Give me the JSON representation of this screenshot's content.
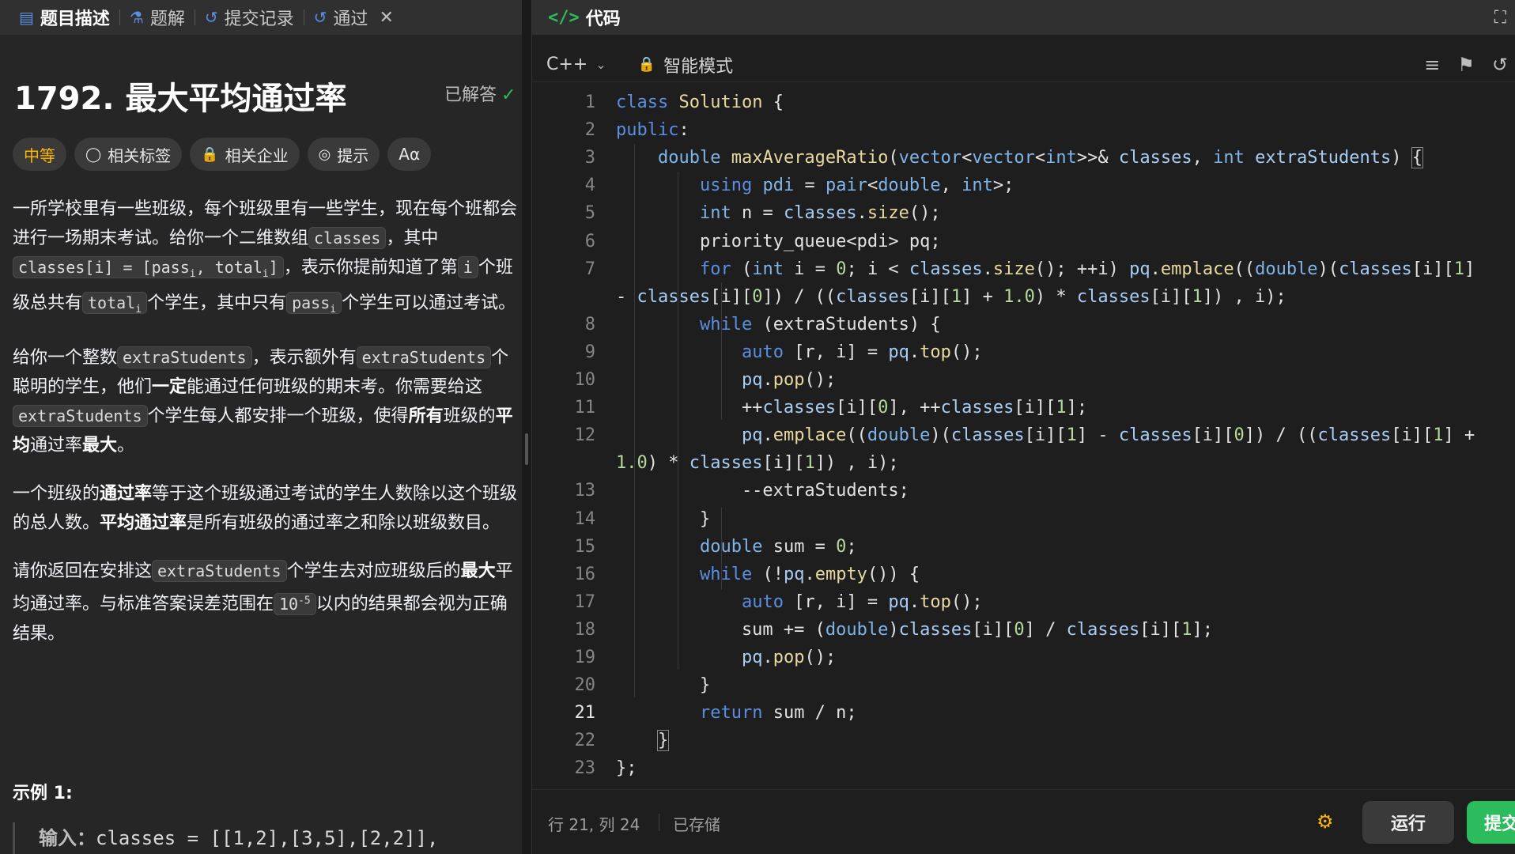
{
  "left_tabs": [
    {
      "icon": "document-icon",
      "label": "题目描述",
      "active": true
    },
    {
      "icon": "flask-icon",
      "label": "题解",
      "active": false
    },
    {
      "icon": "history-icon",
      "label": "提交记录",
      "active": false
    },
    {
      "icon": "history-icon",
      "label": "通过",
      "active": false
    }
  ],
  "problem": {
    "title": "1792. 最大平均通过率",
    "status": "已解答",
    "tags": {
      "difficulty": "中等",
      "related_tags": "相关标签",
      "related_companies": "相关企业",
      "hints": "提示",
      "font": "Aα"
    }
  },
  "description": {
    "p1_a": "一所学校里有一些班级，每个班级里有一些学生，现在每个班都会进行一场期末考试。给你一个二维数组",
    "p1_classes": "classes",
    "p1_b": "，其中",
    "p1_classes_i": "classes[i] = [pass",
    "p1_classes_i_mid": ", total",
    "p1_classes_i_end": "]",
    "p1_c": "，表示你提前知道了第",
    "p1_i": "i",
    "p1_d": "个班级总共有",
    "p1_total": "total",
    "p1_e": "个学生，其中只有",
    "p1_pass": "pass",
    "p1_f": "个学生可以通过考试。",
    "sub_i": "i",
    "p2_a": "给你一个整数",
    "p2_extra": "extraStudents",
    "p2_b": "，表示额外有",
    "p2_c": "个聪明的学生，他们",
    "p2_yiding": "一定",
    "p2_d": "能通过任何班级的期末考。你需要给这",
    "p2_e": "个学生每人都安排一个班级，使得",
    "p2_suoyou": "所有",
    "p2_f": "班级的",
    "p2_pingjun": "平均",
    "p2_g": "通过率",
    "p2_zuida": "最大",
    "p2_h": "。",
    "p3_a": "一个班级的",
    "p3_tongguolv": "通过率",
    "p3_b": "等于这个班级通过考试的学生人数除以这个班级的总人数。",
    "p3_pingjuntongguolv": "平均通过率",
    "p3_c": "是所有班级的通过率之和除以班级数目。",
    "p4_a": "请你返回在安排这",
    "p4_b": "个学生去对应班级后的",
    "p4_zuida": "最大",
    "p4_c": "平均通过率。与标准答案误差范围在",
    "p4_ten": "10",
    "p4_exp": "-5",
    "p4_d": "以内的结果都会视为正确结果。"
  },
  "example": {
    "title": "示例 1:",
    "input_label": "输入：",
    "input_value": "classes = [[1,2],[3,5],[2,2]],"
  },
  "code_panel": {
    "title": "代码",
    "language": "C++",
    "mode": "智能模式",
    "status_position": "行 21, 列 24",
    "status_saved": "已存储",
    "run_label": "运行",
    "submit_label": "提交"
  },
  "code_lines": [
    {
      "n": "1",
      "html": "<span class=\"kw\">class</span> <span class=\"cls\">Solution</span> {"
    },
    {
      "n": "2",
      "html": "<span class=\"kw\">public</span>:"
    },
    {
      "n": "3",
      "html": "    <span class=\"ty\">double</span> <span class=\"fn\">maxAverageRatio</span>(<span class=\"ty\">vector</span>&lt;<span class=\"ty\">vector</span>&lt;<span class=\"ty\">int</span>&gt;&gt;&amp; <span class=\"vr\">classes</span>, <span class=\"ty\">int</span> <span class=\"vr\">extraStudents</span>) <span class=\"br\">{</span>"
    },
    {
      "n": "4",
      "html": "        <span class=\"kw\">using</span> <span class=\"ty\">pdi</span> = <span class=\"ty\">pair</span>&lt;<span class=\"ty\">double</span>, <span class=\"ty\">int</span>&gt;;"
    },
    {
      "n": "5",
      "html": "        <span class=\"ty\">int</span> n = <span class=\"vr\">classes</span>.<span class=\"fn\">size</span>();"
    },
    {
      "n": "6",
      "html": "        priority_queue&lt;pdi&gt; pq;"
    },
    {
      "n": "7",
      "html": "        <span class=\"kw\">for</span> (<span class=\"ty\">int</span> i = <span class=\"nm\">0</span>; i &lt; <span class=\"vr\">classes</span>.<span class=\"fn\">size</span>(); ++i) <span class=\"vr\">pq</span>.<span class=\"fn\">emplace</span>((<span class=\"ty\">double</span>)(<span class=\"vr\">classes</span>[i][<span class=\"nm\">1</span>]"
    },
    {
      "n": "",
      "html": "- <span class=\"vr\">classes</span>[i][<span class=\"nm\">0</span>]) / ((<span class=\"vr\">classes</span>[i][<span class=\"nm\">1</span>] + <span class=\"nm\">1.0</span>) * <span class=\"vr\">classes</span>[i][<span class=\"nm\">1</span>]) , i);"
    },
    {
      "n": "8",
      "html": "        <span class=\"kw\">while</span> (extraStudents) {"
    },
    {
      "n": "9",
      "html": "            <span class=\"kw\">auto</span> [r, i] = <span class=\"vr\">pq</span>.<span class=\"fn\">top</span>();"
    },
    {
      "n": "10",
      "html": "            <span class=\"vr\">pq</span>.<span class=\"fn\">pop</span>();"
    },
    {
      "n": "11",
      "html": "            ++<span class=\"vr\">classes</span>[i][<span class=\"nm\">0</span>], ++<span class=\"vr\">classes</span>[i][<span class=\"nm\">1</span>];"
    },
    {
      "n": "12",
      "html": "            <span class=\"vr\">pq</span>.<span class=\"fn\">emplace</span>((<span class=\"ty\">double</span>)(<span class=\"vr\">classes</span>[i][<span class=\"nm\">1</span>] - <span class=\"vr\">classes</span>[i][<span class=\"nm\">0</span>]) / ((<span class=\"vr\">classes</span>[i][<span class=\"nm\">1</span>] +"
    },
    {
      "n": "",
      "html": "<span class=\"nm\">1.0</span>) * <span class=\"vr\">classes</span>[i][<span class=\"nm\">1</span>]) , i);"
    },
    {
      "n": "13",
      "html": "            --extraStudents;"
    },
    {
      "n": "14",
      "html": "        }"
    },
    {
      "n": "15",
      "html": "        <span class=\"ty\">double</span> sum = <span class=\"nm\">0</span>;"
    },
    {
      "n": "16",
      "html": "        <span class=\"kw\">while</span> (!<span class=\"vr\">pq</span>.<span class=\"fn\">empty</span>()) {"
    },
    {
      "n": "17",
      "html": "            <span class=\"kw\">auto</span> [r, i] = <span class=\"vr\">pq</span>.<span class=\"fn\">top</span>();"
    },
    {
      "n": "18",
      "html": "            sum += (<span class=\"ty\">double</span>)<span class=\"vr\">classes</span>[i][<span class=\"nm\">0</span>] / <span class=\"vr\">classes</span>[i][<span class=\"nm\">1</span>];"
    },
    {
      "n": "19",
      "html": "            <span class=\"vr\">pq</span>.<span class=\"fn\">pop</span>();"
    },
    {
      "n": "20",
      "html": "        }"
    },
    {
      "n": "21",
      "html": "        <span class=\"kw\">return</span> sum / n;"
    },
    {
      "n": "22",
      "html": "    <span class=\"br\">}</span>"
    },
    {
      "n": "23",
      "html": "};"
    }
  ],
  "current_line": "21",
  "colors": {
    "accent_green": "#2cbb5d",
    "difficulty_medium": "#ffb800"
  }
}
